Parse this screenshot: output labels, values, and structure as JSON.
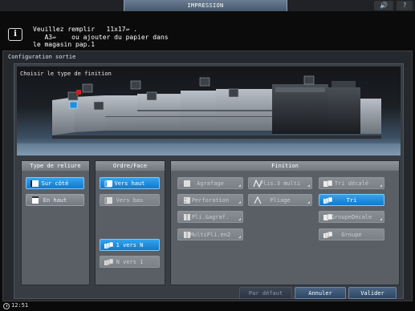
{
  "header": {
    "mode_tab": "IMPRESSION",
    "volume_icon": "speaker-icon",
    "help_label": "?"
  },
  "message": {
    "icon": "info-icon",
    "icon_glyph": "i",
    "lines": [
      "Veuillez remplir   11x17▱ .",
      "   A3▱    ou ajouter du papier dans",
      "le magasin pap.1"
    ]
  },
  "panel": {
    "title": "Configuration sortie",
    "subtitle": "Choisir le type de finition"
  },
  "groups": {
    "reliure": {
      "title": "Type de reliure",
      "buttons": [
        {
          "label": "Sur côté",
          "selected": true,
          "enabled": true,
          "icon": "side-binding-icon"
        },
        {
          "label": "En haut",
          "selected": false,
          "enabled": true,
          "icon": "top-binding-icon"
        }
      ]
    },
    "ordre": {
      "title": "Ordre/Face",
      "buttons": [
        {
          "label": "Vers haut",
          "selected": true,
          "enabled": true,
          "icon": "face-up-icon"
        },
        {
          "label": "Vers bas",
          "selected": false,
          "enabled": false,
          "icon": "face-down-icon"
        },
        {
          "label": "1 vers N",
          "selected": true,
          "enabled": true,
          "icon": "one-to-n-icon"
        },
        {
          "label": "N vers 1",
          "selected": false,
          "enabled": false,
          "icon": "n-to-one-icon"
        }
      ]
    },
    "finition": {
      "title": "Finition",
      "buttons": [
        {
          "label": "Agrafage",
          "selected": false,
          "enabled": false,
          "icon": "staple-icon"
        },
        {
          "label": "Plis.3 multi",
          "selected": false,
          "enabled": false,
          "icon": "tri-fold-icon"
        },
        {
          "label": "Tri décalé",
          "selected": false,
          "enabled": false,
          "icon": "offset-sort-icon"
        },
        {
          "label": "Perforation",
          "selected": false,
          "enabled": false,
          "icon": "punch-icon"
        },
        {
          "label": "Pliage",
          "selected": false,
          "enabled": false,
          "icon": "fold-icon"
        },
        {
          "label": "Tri",
          "selected": true,
          "enabled": true,
          "icon": "sort-icon"
        },
        {
          "label": "Pli.&agraf.",
          "selected": false,
          "enabled": false,
          "icon": "fold-staple-icon"
        },
        {
          "label": "GroupeDécale",
          "selected": false,
          "enabled": false,
          "icon": "group-offset-icon"
        },
        {
          "label": "MultiPli.en2",
          "selected": false,
          "enabled": false,
          "icon": "multi-half-fold-icon"
        },
        {
          "label": "Groupe",
          "selected": false,
          "enabled": false,
          "icon": "group-icon"
        }
      ]
    }
  },
  "footer": {
    "default_label": "Par défaut",
    "cancel_label": "Annuler",
    "ok_label": "Valider"
  },
  "status": {
    "clock_icon": "clock-icon",
    "time": "12:51"
  },
  "colors": {
    "selected": "#1f8fe0",
    "button": "#80868c",
    "background": "#25282c",
    "footer_button": "#3b5673"
  }
}
